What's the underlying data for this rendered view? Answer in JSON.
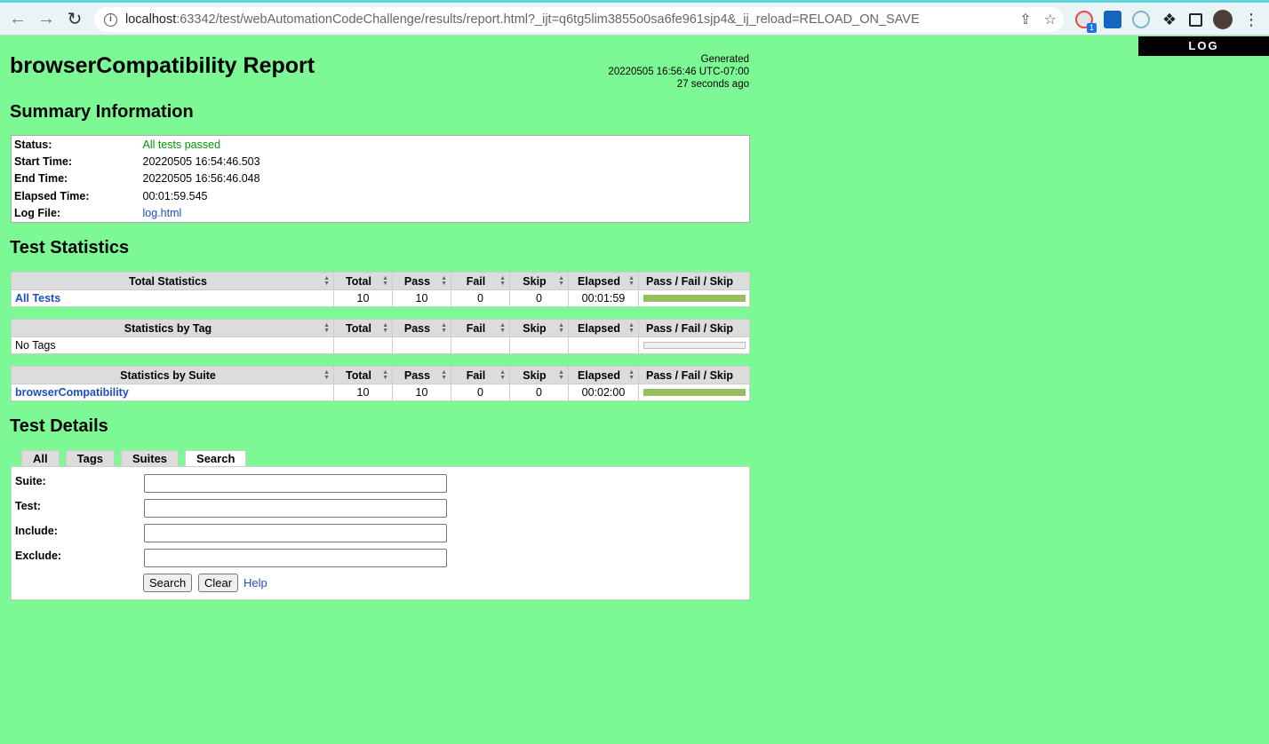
{
  "browser": {
    "url_host": "localhost",
    "url_rest": ":63342/test/webAutomationCodeChallenge/results/report.html?_ijt=q6tg5lim3855o0sa6fe961sjp4&_ij_reload=RELOAD_ON_SAVE",
    "extension_badge": "1"
  },
  "log_button": "LOG",
  "title": "browserCompatibility Report",
  "generated": {
    "label": "Generated",
    "timestamp": "20220505 16:56:46 UTC-07:00",
    "ago": "27 seconds ago"
  },
  "summary": {
    "heading": "Summary Information",
    "rows": [
      {
        "key": "Status:",
        "value": "All tests passed"
      },
      {
        "key": "Start Time:",
        "value": "20220505 16:54:46.503"
      },
      {
        "key": "End Time:",
        "value": "20220505 16:56:46.048"
      },
      {
        "key": "Elapsed Time:",
        "value": "00:01:59.545"
      },
      {
        "key": "Log File:",
        "value": "log.html"
      }
    ]
  },
  "statistics": {
    "heading": "Test Statistics",
    "columns": [
      "Total",
      "Pass",
      "Fail",
      "Skip",
      "Elapsed",
      "Pass / Fail / Skip"
    ],
    "tables": [
      {
        "title": "Total Statistics",
        "rows": [
          {
            "name": "All Tests",
            "total": "10",
            "pass": "10",
            "fail": "0",
            "skip": "0",
            "elapsed": "00:01:59",
            "pass_fraction": 1.0
          }
        ]
      },
      {
        "title": "Statistics by Tag",
        "rows": [
          {
            "name": "No Tags",
            "total": "",
            "pass": "",
            "fail": "",
            "skip": "",
            "elapsed": "",
            "pass_fraction": 0.0
          }
        ]
      },
      {
        "title": "Statistics by Suite",
        "rows": [
          {
            "name": "browserCompatibility",
            "total": "10",
            "pass": "10",
            "fail": "0",
            "skip": "0",
            "elapsed": "00:02:00",
            "pass_fraction": 1.0
          }
        ]
      }
    ]
  },
  "details": {
    "heading": "Test Details",
    "tabs": [
      "All",
      "Tags",
      "Suites",
      "Search"
    ],
    "active_tab": "Search",
    "fields": [
      {
        "label": "Suite:",
        "value": ""
      },
      {
        "label": "Test:",
        "value": ""
      },
      {
        "label": "Include:",
        "value": ""
      },
      {
        "label": "Exclude:",
        "value": ""
      }
    ],
    "search_button": "Search",
    "clear_button": "Clear",
    "help_link": "Help"
  },
  "colors": {
    "background": "#7cf994",
    "pass_bar": "#97bd61",
    "link": "#1d4ec8",
    "pass_text": "#009900"
  }
}
